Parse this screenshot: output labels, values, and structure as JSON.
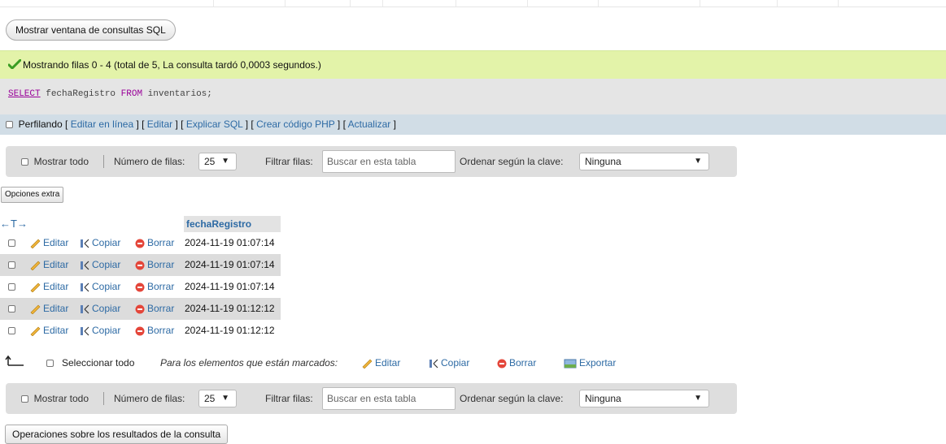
{
  "top": {
    "sql_window_button": "Mostrar ventana de consultas SQL"
  },
  "status": {
    "message": "Mostrando filas 0 - 4 (total de 5, La consulta tardó 0,0003 segundos.)"
  },
  "query": {
    "kw_select": "SELECT",
    "col": "fechaRegistro",
    "kw_from": "FROM",
    "table": "inventarios;"
  },
  "profiling": {
    "label": "Perfilando",
    "links": [
      "Editar en línea",
      "Editar",
      "Explicar SQL",
      "Crear código PHP",
      "Actualizar"
    ]
  },
  "navbar": {
    "show_all": "Mostrar todo",
    "rows_label": "Número de filas:",
    "rows_value": "25",
    "filter_label": "Filtrar filas:",
    "filter_placeholder": "Buscar en esta tabla",
    "sort_label": "Ordenar según la clave:",
    "sort_value": "Ninguna"
  },
  "extra_options_button": "Opciones extra",
  "table": {
    "nav_arrows": "←T→",
    "column_header": "fechaRegistro",
    "actions": {
      "edit": "Editar",
      "copy": "Copiar",
      "delete": "Borrar"
    },
    "rows": [
      "2024-11-19 01:07:14",
      "2024-11-19 01:07:14",
      "2024-11-19 01:07:14",
      "2024-11-19 01:12:12",
      "2024-11-19 01:12:12"
    ]
  },
  "bulk": {
    "select_all": "Seleccionar todo",
    "for_marked": "Para los elementos que están marcados:",
    "edit": "Editar",
    "copy": "Copiar",
    "delete": "Borrar",
    "export": "Exportar"
  },
  "operations_button": "Operaciones sobre los resultados de la consulta",
  "colors": {
    "success_bg": "#e3f3a9",
    "link": "#2d6aa4",
    "keyword": "#990099",
    "profiling_bg": "#d1dde6"
  }
}
